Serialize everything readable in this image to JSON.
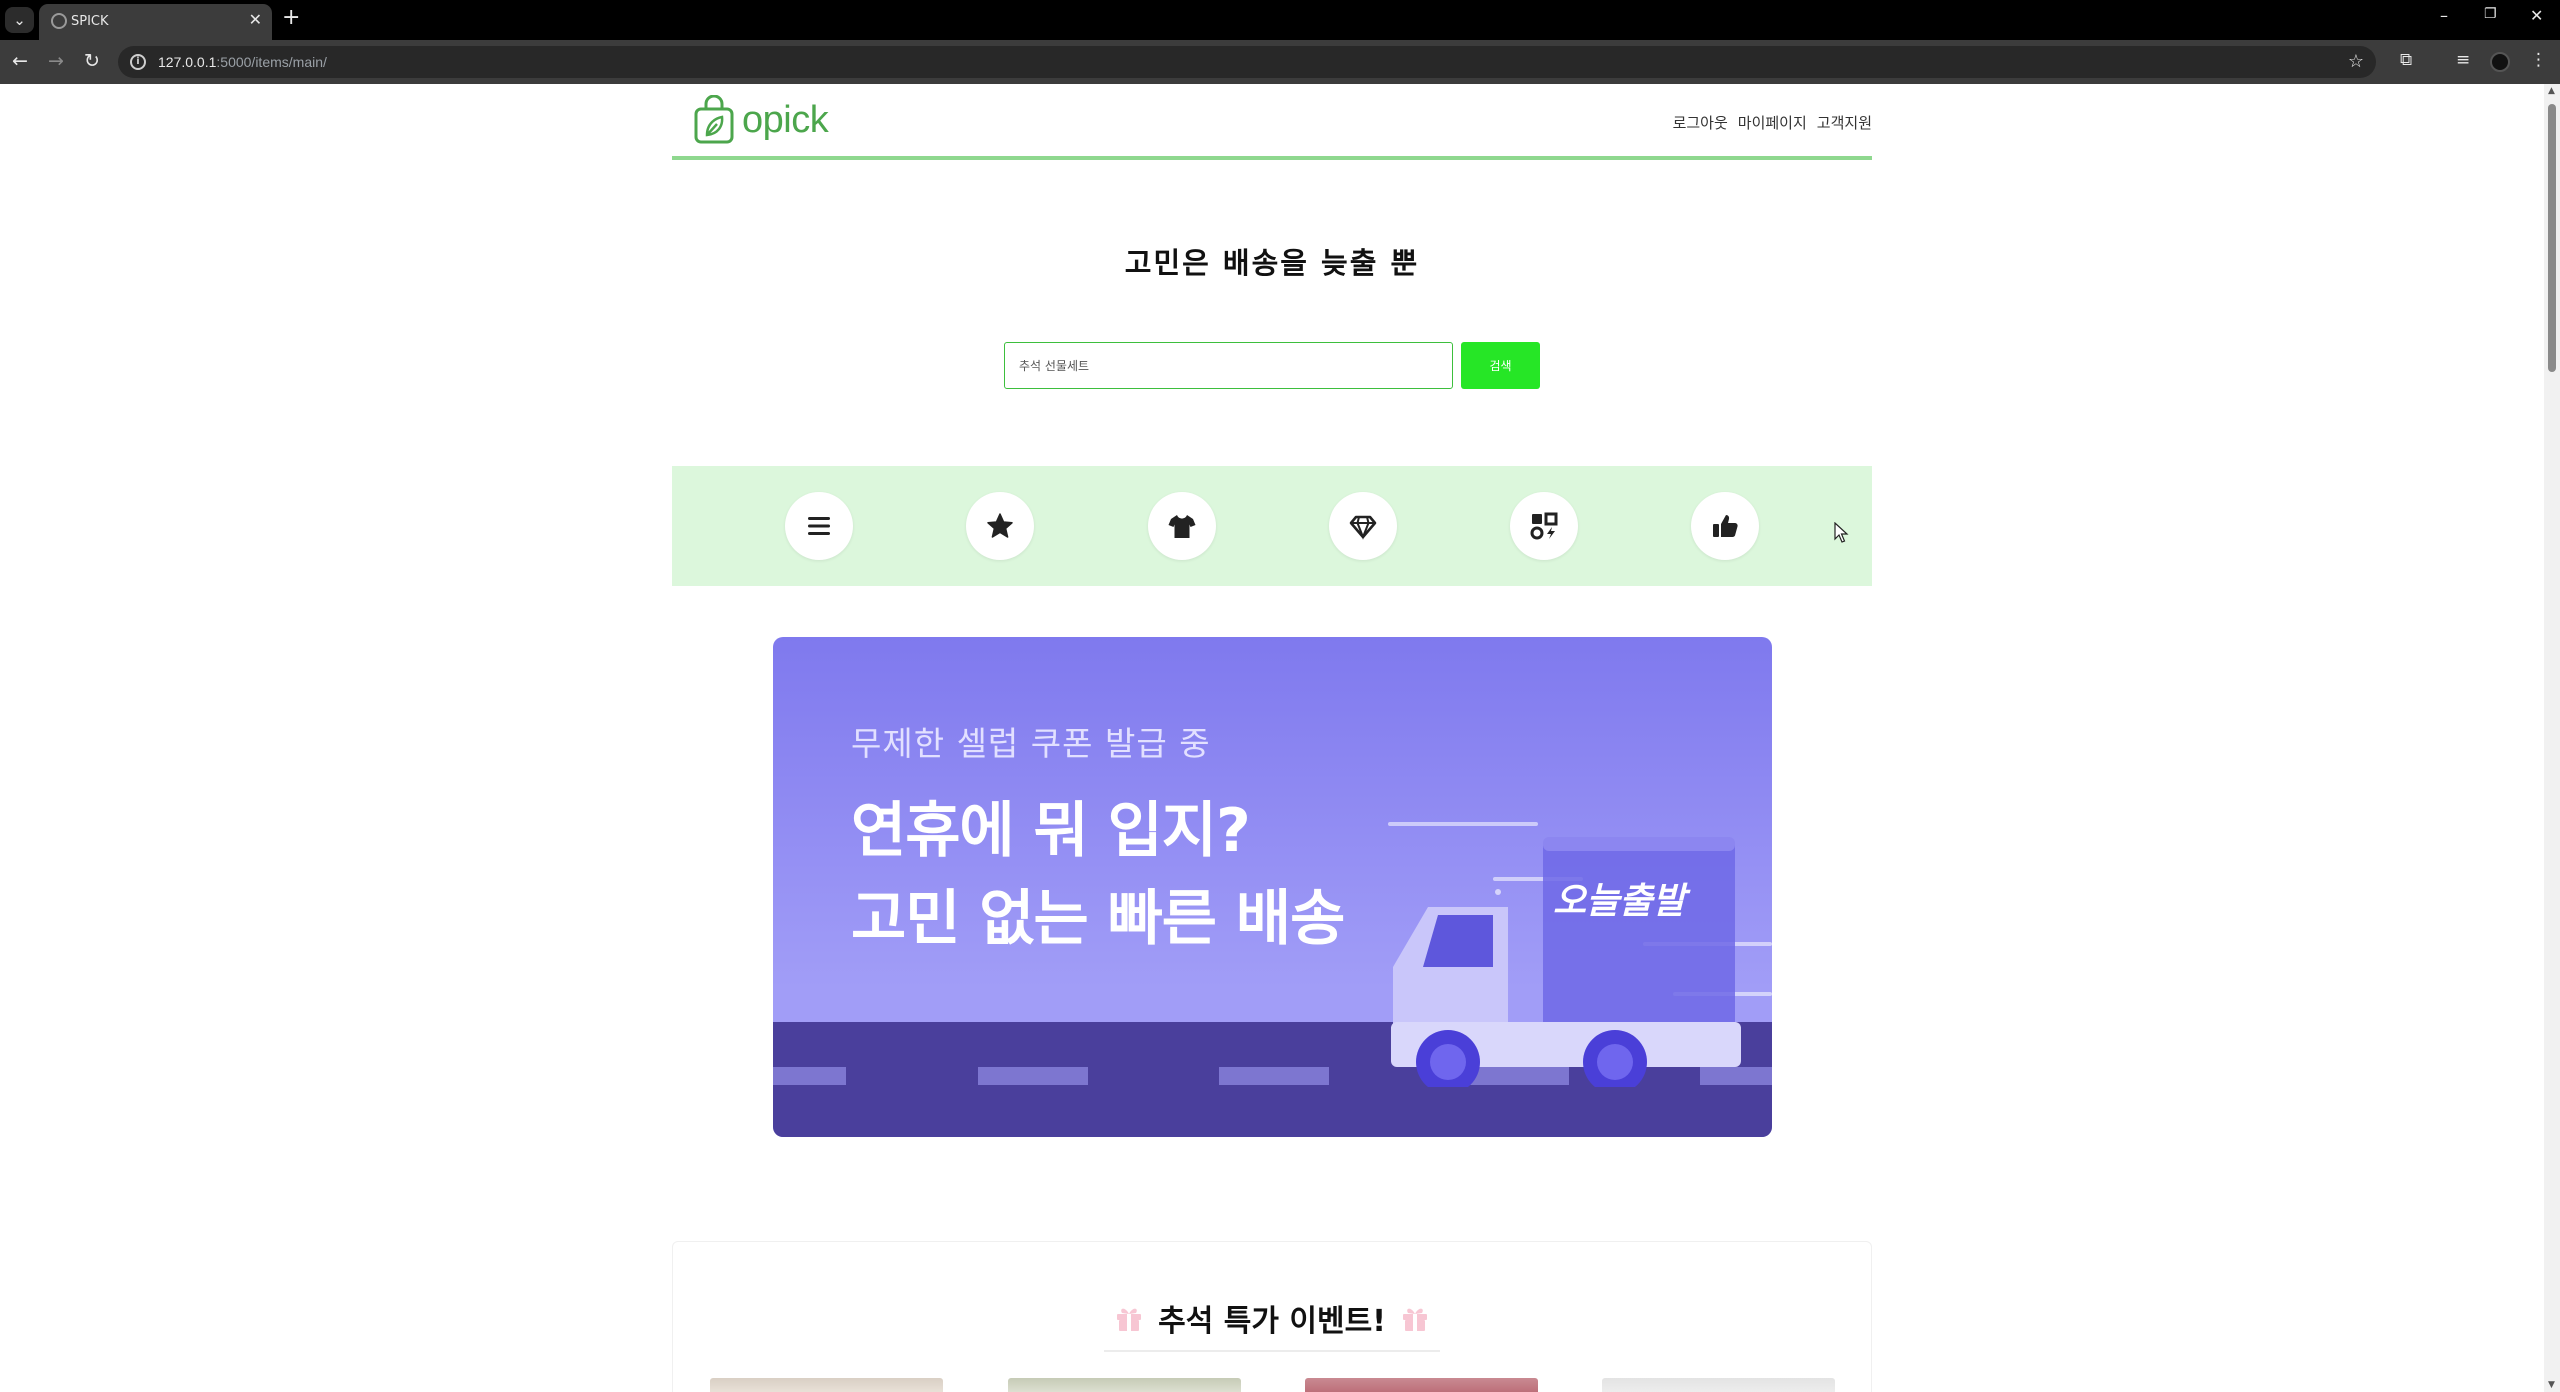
{
  "browser": {
    "tab_title": "SPICK",
    "tab_favicon": "globe-icon",
    "url_host": "127.0.0.1",
    "url_rest": ":5000/items/main/"
  },
  "header": {
    "logo_text": "opick",
    "nav": [
      "로그아웃",
      "마이페이지",
      "고객지원"
    ]
  },
  "hero": {
    "title": "고민은 배송을 늦출 뿐",
    "search_value": "추석 선물세트",
    "search_button": "검색"
  },
  "categories": [
    {
      "icon": "menu-icon"
    },
    {
      "icon": "star-icon"
    },
    {
      "icon": "tshirt-icon"
    },
    {
      "icon": "gem-icon"
    },
    {
      "icon": "category-shapes-icon"
    },
    {
      "icon": "thumbs-up-icon"
    }
  ],
  "banner": {
    "subtitle": "무제한 셀럽 쿠폰 발급 중",
    "headline_1": "연휴에 뭐 입지?",
    "headline_2": "고민 없는 빠른 배송",
    "truck_label": "오늘출발"
  },
  "event": {
    "title": "추석 특가 이벤트!",
    "icon": "gift-icon"
  },
  "colors": {
    "brand_green": "#4ca64c",
    "button_green": "#26e626",
    "strip_green": "#dcf7dc",
    "banner_purple": "#7f79ee"
  }
}
